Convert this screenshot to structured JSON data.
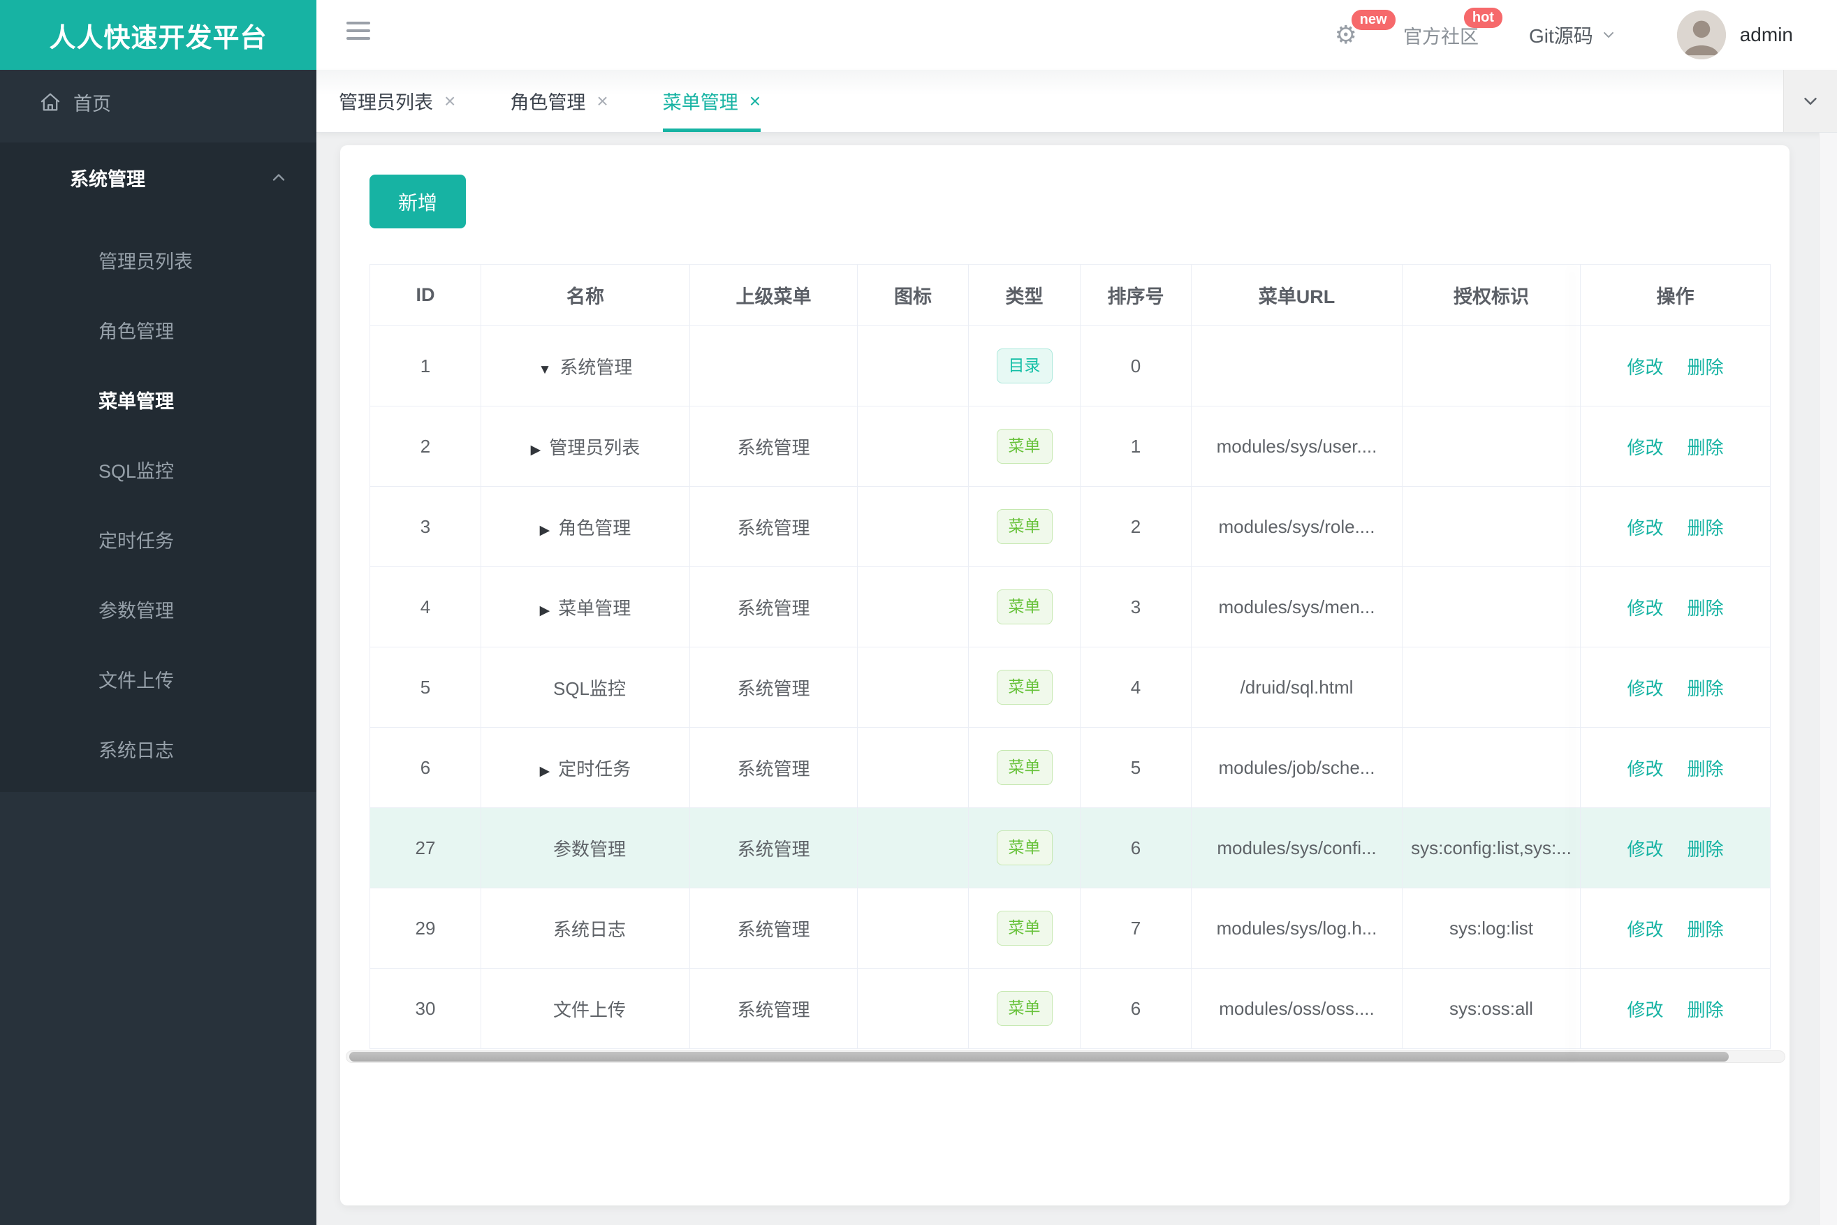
{
  "brand": {
    "title": "人人快速开发平台"
  },
  "topbar": {
    "gear_badge": "new",
    "community_label": "官方社区",
    "community_badge": "hot",
    "git_label": "Git源码",
    "username": "admin"
  },
  "sidebar": {
    "home_label": "首页",
    "group": {
      "label": "系统管理",
      "items": [
        {
          "label": "管理员列表",
          "active": false
        },
        {
          "label": "角色管理",
          "active": false
        },
        {
          "label": "菜单管理",
          "active": true
        },
        {
          "label": "SQL监控",
          "active": false
        },
        {
          "label": "定时任务",
          "active": false
        },
        {
          "label": "参数管理",
          "active": false
        },
        {
          "label": "文件上传",
          "active": false
        },
        {
          "label": "系统日志",
          "active": false
        }
      ]
    }
  },
  "tabs": [
    {
      "label": "管理员列表",
      "active": false
    },
    {
      "label": "角色管理",
      "active": false
    },
    {
      "label": "菜单管理",
      "active": true
    }
  ],
  "toolbar": {
    "add_label": "新增"
  },
  "table": {
    "columns": [
      "ID",
      "名称",
      "上级菜单",
      "图标",
      "类型",
      "排序号",
      "菜单URL",
      "授权标识",
      "操作"
    ],
    "badge_types": {
      "dir": "目录",
      "menu": "菜单"
    },
    "actions": {
      "edit": "修改",
      "delete": "删除"
    },
    "rows": [
      {
        "id": "1",
        "arrow": "down",
        "name": "系统管理",
        "parent": "",
        "type": "dir",
        "order": "0",
        "url": "",
        "perm": "",
        "highlight": false
      },
      {
        "id": "2",
        "arrow": "right",
        "name": "管理员列表",
        "parent": "系统管理",
        "type": "menu",
        "order": "1",
        "url": "modules/sys/user....",
        "perm": "",
        "highlight": false
      },
      {
        "id": "3",
        "arrow": "right",
        "name": "角色管理",
        "parent": "系统管理",
        "type": "menu",
        "order": "2",
        "url": "modules/sys/role....",
        "perm": "",
        "highlight": false
      },
      {
        "id": "4",
        "arrow": "right",
        "name": "菜单管理",
        "parent": "系统管理",
        "type": "menu",
        "order": "3",
        "url": "modules/sys/men...",
        "perm": "",
        "highlight": false
      },
      {
        "id": "5",
        "arrow": "none",
        "name": "SQL监控",
        "parent": "系统管理",
        "type": "menu",
        "order": "4",
        "url": "/druid/sql.html",
        "perm": "",
        "highlight": false
      },
      {
        "id": "6",
        "arrow": "right",
        "name": "定时任务",
        "parent": "系统管理",
        "type": "menu",
        "order": "5",
        "url": "modules/job/sche...",
        "perm": "",
        "highlight": false
      },
      {
        "id": "27",
        "arrow": "none",
        "name": "参数管理",
        "parent": "系统管理",
        "type": "menu",
        "order": "6",
        "url": "modules/sys/confi...",
        "perm": "sys:config:list,sys:...",
        "highlight": true
      },
      {
        "id": "29",
        "arrow": "none",
        "name": "系统日志",
        "parent": "系统管理",
        "type": "menu",
        "order": "7",
        "url": "modules/sys/log.h...",
        "perm": "sys:log:list",
        "highlight": false
      },
      {
        "id": "30",
        "arrow": "none",
        "name": "文件上传",
        "parent": "系统管理",
        "type": "menu",
        "order": "6",
        "url": "modules/oss/oss....",
        "perm": "sys:oss:all",
        "highlight": false
      }
    ]
  },
  "colors": {
    "accent": "#17B3A3",
    "badge_red": "#F6696B",
    "sidebar_bg": "#28323B",
    "sidebar_group_bg": "#222B33",
    "row_highlight": "#E7F6F2",
    "tag_dir_text": "#13BFA6",
    "tag_menu_text": "#67C23A"
  }
}
